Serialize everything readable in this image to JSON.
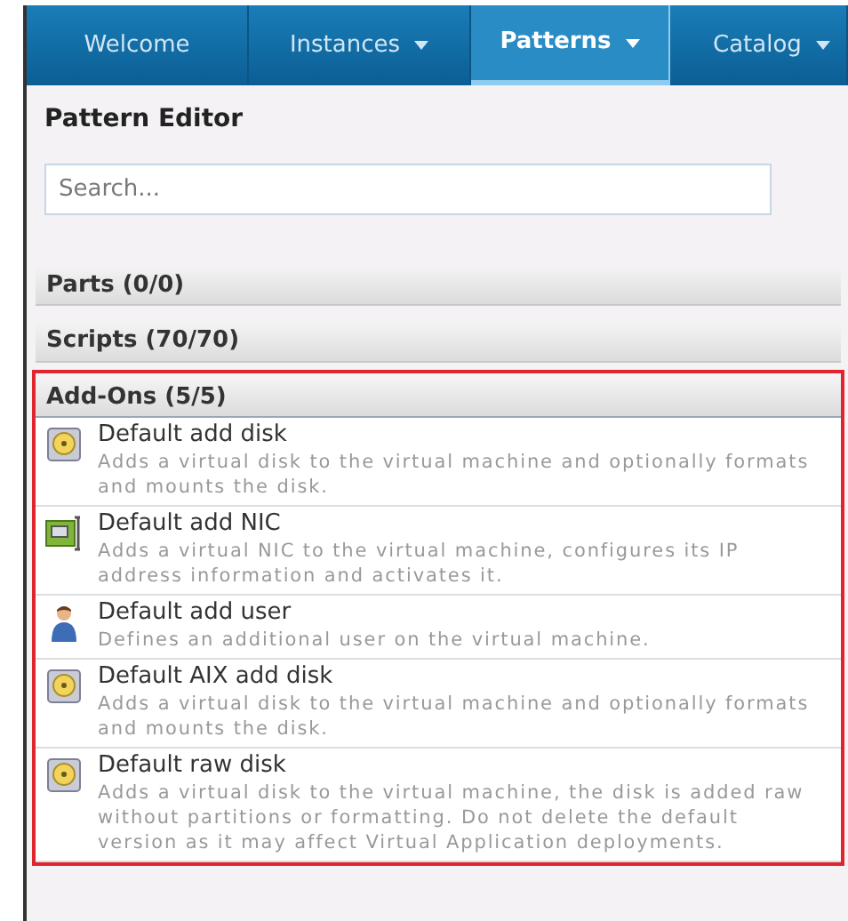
{
  "nav_tabs": [
    {
      "label": "Welcome",
      "dropdown": false,
      "selected": false
    },
    {
      "label": "Instances",
      "dropdown": true,
      "selected": false
    },
    {
      "label": "Patterns",
      "dropdown": true,
      "selected": true
    },
    {
      "label": "Catalog",
      "dropdown": true,
      "selected": false
    }
  ],
  "title": "Pattern Editor",
  "search": {
    "placeholder": "Search..."
  },
  "sections": [
    {
      "label": "Parts (0/0)",
      "expanded": false,
      "highlighted": false
    },
    {
      "label": "Scripts (70/70)",
      "expanded": false,
      "highlighted": false
    },
    {
      "label": "Add-Ons (5/5)",
      "expanded": true,
      "highlighted": true,
      "items": [
        {
          "kind": "disk",
          "name": "Default add disk",
          "description": "Adds a virtual disk to the virtual machine and optionally formats and mounts the disk."
        },
        {
          "kind": "nic",
          "name": "Default add NIC",
          "description": "Adds a virtual NIC to the virtual machine, configures its IP address information and activates it."
        },
        {
          "kind": "user",
          "name": "Default add user",
          "description": "Defines an additional user on the virtual machine."
        },
        {
          "kind": "disk",
          "name": "Default AIX add disk",
          "description": "Adds a virtual disk to the virtual machine and optionally formats and mounts the disk."
        },
        {
          "kind": "disk",
          "name": "Default raw disk",
          "description": "Adds a virtual disk to the virtual machine, the disk is added raw without partitions or formatting. Do not delete the default version as it may affect Virtual Application deployments."
        }
      ]
    }
  ]
}
